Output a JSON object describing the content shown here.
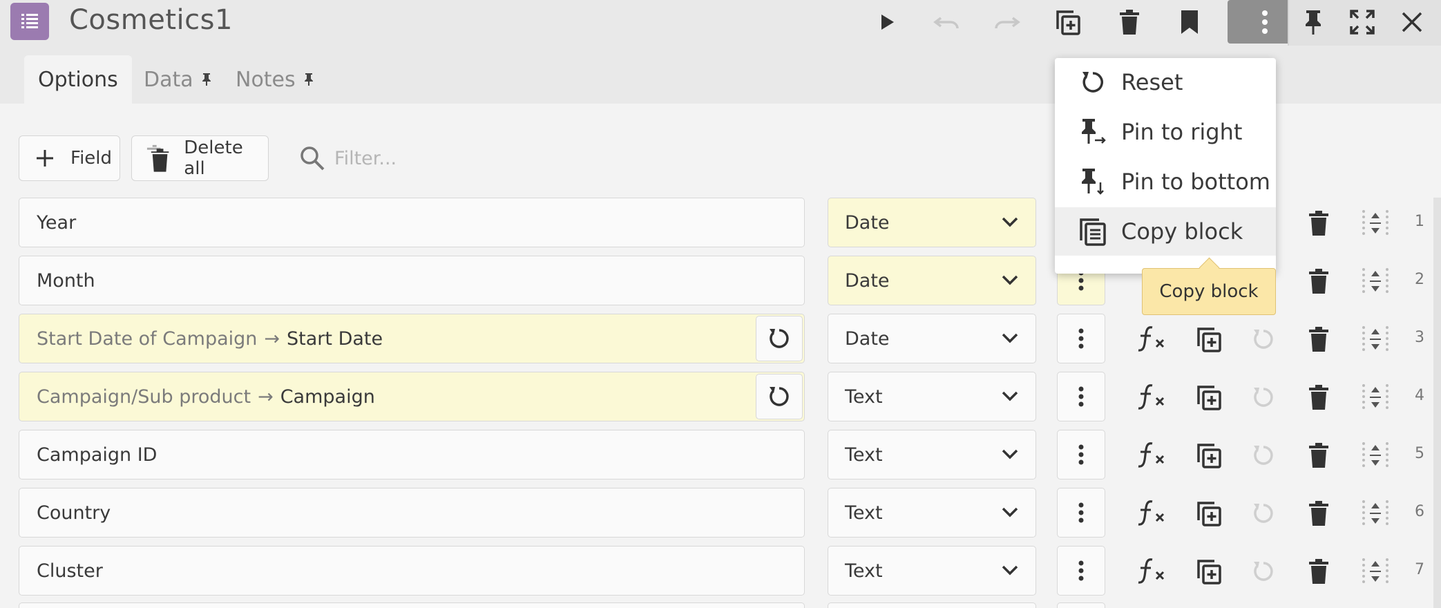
{
  "window": {
    "title": "Cosmetics1"
  },
  "toolbar": {
    "run": "play-icon",
    "undo": "undo-icon",
    "redo": "redo-icon",
    "duplicate": "duplicate-icon",
    "delete": "trash-icon",
    "bookmark": "bookmark-icon",
    "more": "more-vertical-icon",
    "pin": "pin-icon",
    "expand": "expand-icon",
    "close": "close-icon"
  },
  "tabs": [
    {
      "label": "Options",
      "active": true
    },
    {
      "label": "Data",
      "pinned": true
    },
    {
      "label": "Notes",
      "pinned": true
    }
  ],
  "actions": {
    "add_field_label": "Field",
    "delete_all_label": "Delete all",
    "filter_placeholder": "Filter..."
  },
  "rows": [
    {
      "num": "1",
      "name": "Year",
      "type": "Date"
    },
    {
      "num": "2",
      "name": "Month",
      "type": "Date"
    },
    {
      "num": "3",
      "original": "Start Date of Campaign",
      "arrow": "→",
      "name": "Start Date",
      "type": "Date"
    },
    {
      "num": "4",
      "original": "Campaign/Sub product",
      "arrow": "→",
      "name": "Campaign",
      "type": "Text"
    },
    {
      "num": "5",
      "name": "Campaign ID",
      "type": "Text"
    },
    {
      "num": "6",
      "name": "Country",
      "type": "Text"
    },
    {
      "num": "7",
      "name": "Cluster",
      "type": "Text"
    }
  ],
  "menu": {
    "items": [
      {
        "label": "Reset",
        "icon": "reset-icon"
      },
      {
        "label": "Pin to right",
        "icon": "pin-right-icon"
      },
      {
        "label": "Pin to bottom",
        "icon": "pin-bottom-icon"
      },
      {
        "label": "Copy block",
        "icon": "copy-block-icon"
      }
    ]
  },
  "tooltip": {
    "text": "Copy block"
  },
  "colors": {
    "app_icon": "#9b7bb0",
    "highlight": "#fbf9d6",
    "tooltip": "#fbe7a8"
  }
}
